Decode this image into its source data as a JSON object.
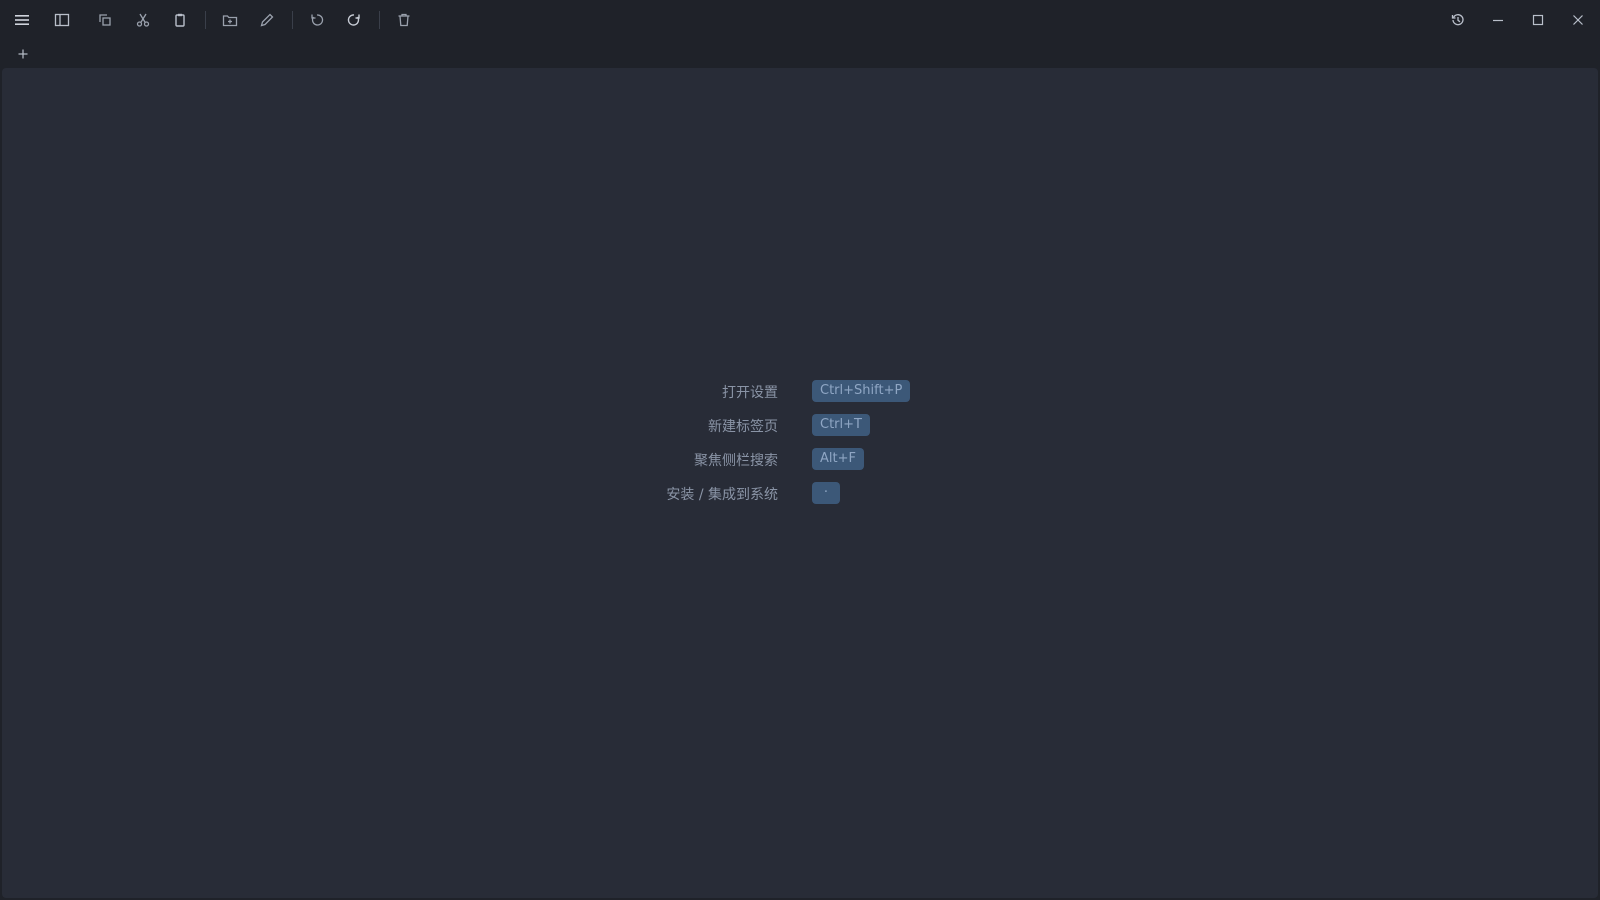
{
  "toolbar": {
    "left_buttons": [
      {
        "name": "menu-button",
        "icon": "hamburger-icon"
      },
      {
        "name": "sidebar-toggle-button",
        "icon": "sidebar-icon"
      },
      {
        "name": "copy-button",
        "icon": "copy-icon"
      },
      {
        "name": "cut-button",
        "icon": "scissors-icon"
      },
      {
        "name": "paste-button",
        "icon": "clipboard-icon"
      },
      {
        "name": "new-folder-button",
        "icon": "folder-plus-icon"
      },
      {
        "name": "rename-button",
        "icon": "pencil-icon"
      },
      {
        "name": "undo-button",
        "icon": "undo-icon"
      },
      {
        "name": "redo-button",
        "icon": "redo-icon"
      },
      {
        "name": "delete-button",
        "icon": "trash-icon"
      }
    ],
    "right_buttons": [
      {
        "name": "history-button",
        "icon": "history-icon"
      },
      {
        "name": "minimize-button",
        "icon": "minimize-icon"
      },
      {
        "name": "maximize-button",
        "icon": "maximize-icon"
      },
      {
        "name": "close-button",
        "icon": "close-icon"
      }
    ]
  },
  "tabstrip": {
    "new_tab_icon": "plus-icon"
  },
  "shortcuts": [
    {
      "label": "打开设置",
      "key": "Ctrl+Shift+P"
    },
    {
      "label": "新建标签页",
      "key": "Ctrl+T"
    },
    {
      "label": "聚焦侧栏搜索",
      "key": "Alt+F"
    },
    {
      "label": "安装 / 集成到系统",
      "key": "·"
    }
  ],
  "colors": {
    "window_bg": "#1f2229",
    "content_bg": "#282c37",
    "icon": "#b9bfca",
    "label_text": "#8a94a6",
    "key_bg": "#3c5878",
    "key_text": "#8fa6c4"
  }
}
